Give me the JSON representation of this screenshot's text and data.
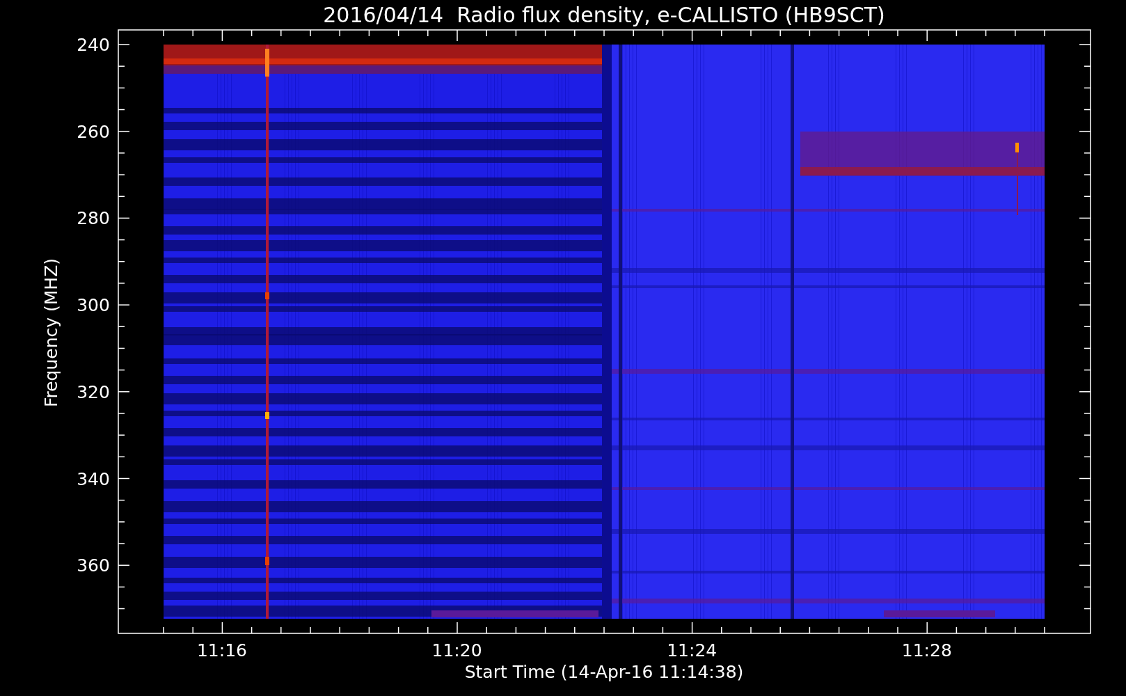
{
  "title": "2016/04/14  Radio flux density, e-CALLISTO (HB9SCT)",
  "y_axis": {
    "label": "Frequency (MHZ)",
    "ticks": [
      "240",
      "260",
      "280",
      "300",
      "320",
      "340",
      "360"
    ]
  },
  "x_axis": {
    "label": "Start Time (14-Apr-16 11:14:38)",
    "ticks": [
      "11:16",
      "11:20",
      "11:24",
      "11:28"
    ]
  }
}
